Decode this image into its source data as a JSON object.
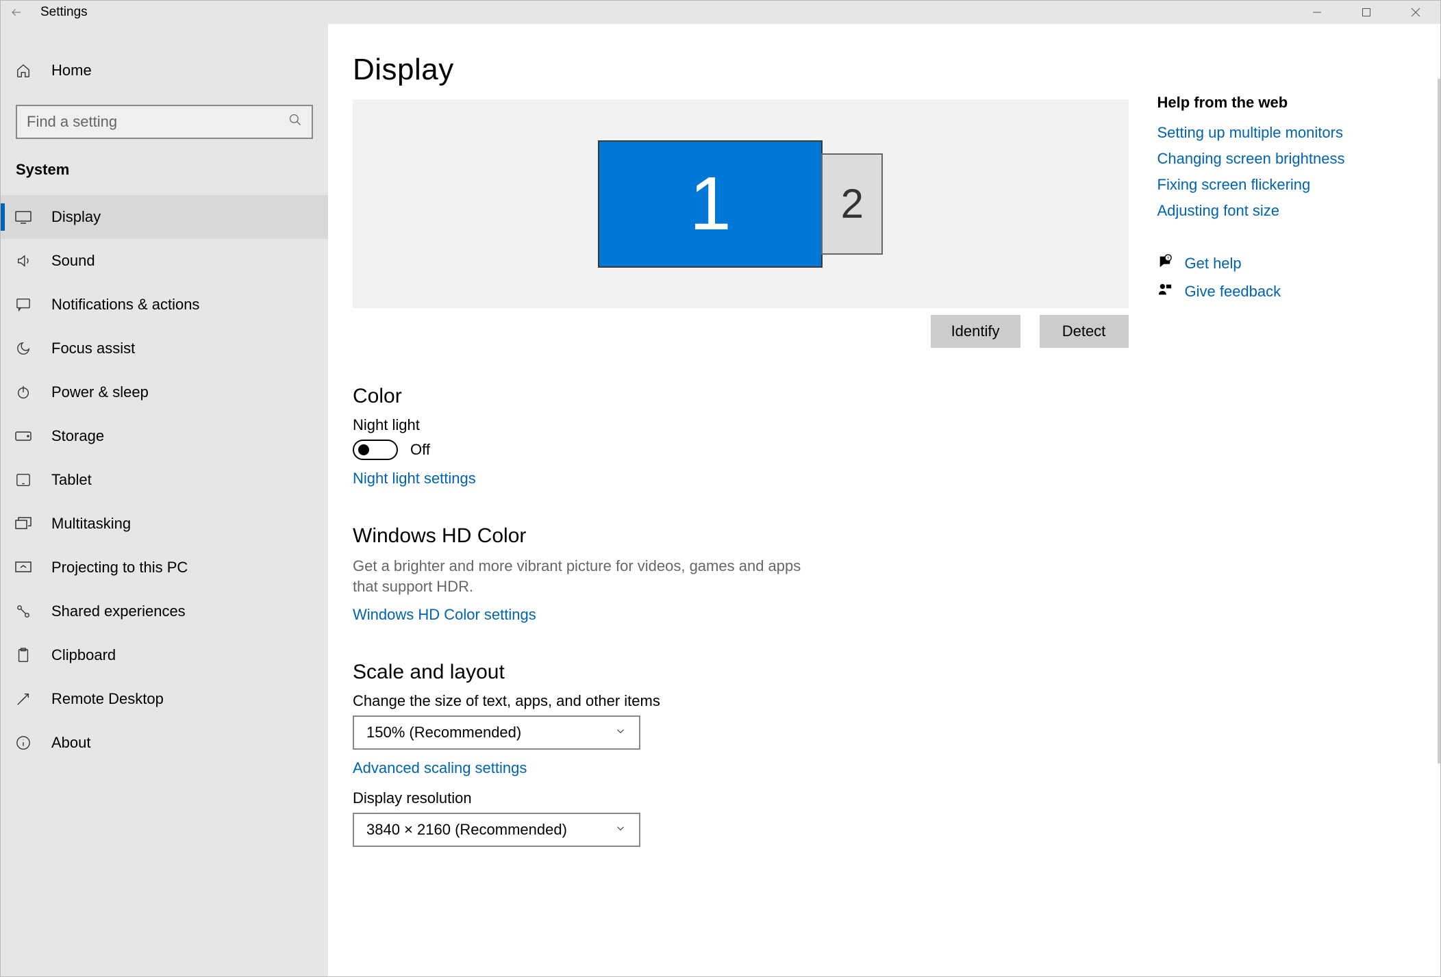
{
  "window": {
    "title": "Settings"
  },
  "sidebar": {
    "home": "Home",
    "search_placeholder": "Find a setting",
    "section": "System",
    "items": [
      {
        "label": "Display",
        "icon": "display-icon",
        "selected": true
      },
      {
        "label": "Sound",
        "icon": "sound-icon"
      },
      {
        "label": "Notifications & actions",
        "icon": "notifications-icon"
      },
      {
        "label": "Focus assist",
        "icon": "focus-assist-icon"
      },
      {
        "label": "Power & sleep",
        "icon": "power-icon"
      },
      {
        "label": "Storage",
        "icon": "storage-icon"
      },
      {
        "label": "Tablet",
        "icon": "tablet-icon"
      },
      {
        "label": "Multitasking",
        "icon": "multitasking-icon"
      },
      {
        "label": "Projecting to this PC",
        "icon": "projecting-icon"
      },
      {
        "label": "Shared experiences",
        "icon": "shared-icon"
      },
      {
        "label": "Clipboard",
        "icon": "clipboard-icon"
      },
      {
        "label": "Remote Desktop",
        "icon": "remote-desktop-icon"
      },
      {
        "label": "About",
        "icon": "about-icon"
      }
    ]
  },
  "page": {
    "title": "Display",
    "monitors": {
      "1": "1",
      "2": "2"
    },
    "identify_btn": "Identify",
    "detect_btn": "Detect",
    "color_heading": "Color",
    "night_light_label": "Night light",
    "night_light_state": "Off",
    "night_light_link": "Night light settings",
    "hdcolor_heading": "Windows HD Color",
    "hdcolor_desc": "Get a brighter and more vibrant picture for videos, games and apps that support HDR.",
    "hdcolor_link": "Windows HD Color settings",
    "scale_heading": "Scale and layout",
    "scale_label": "Change the size of text, apps, and other items",
    "scale_value": "150% (Recommended)",
    "scale_link": "Advanced scaling settings",
    "resolution_label": "Display resolution",
    "resolution_value": "3840 × 2160 (Recommended)"
  },
  "right": {
    "title": "Help from the web",
    "links": [
      "Setting up multiple monitors",
      "Changing screen brightness",
      "Fixing screen flickering",
      "Adjusting font size"
    ],
    "get_help": "Get help",
    "give_feedback": "Give feedback"
  }
}
